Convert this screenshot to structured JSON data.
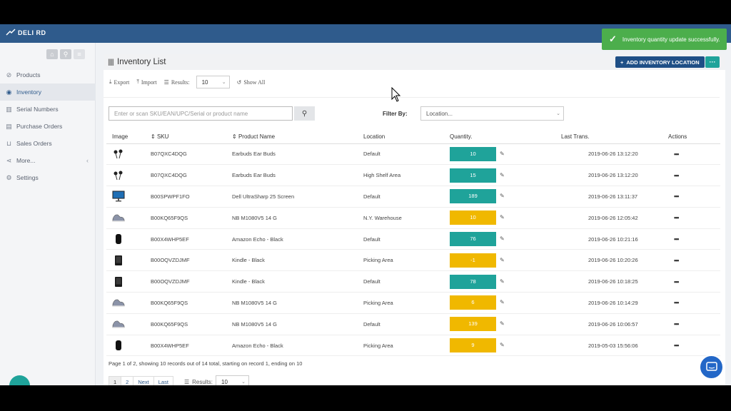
{
  "app": {
    "logo_text": "DELI  RD"
  },
  "toast": {
    "message": "Inventory quantity update successfully."
  },
  "sidebar": {
    "items": [
      {
        "label": "Products",
        "icon": "tag-icon"
      },
      {
        "label": "Inventory",
        "icon": "location-pin-icon",
        "active": true
      },
      {
        "label": "Serial Numbers",
        "icon": "barcode-icon"
      },
      {
        "label": "Purchase Orders",
        "icon": "document-icon"
      },
      {
        "label": "Sales Orders",
        "icon": "cart-icon"
      },
      {
        "label": "More...",
        "icon": "share-icon"
      },
      {
        "label": "Settings",
        "icon": "gear-icon"
      }
    ]
  },
  "panel": {
    "title": "Inventory List",
    "add_button": "ADD INVENTORY LOCATION",
    "more_button": "···"
  },
  "toolbar": {
    "export": "Export",
    "import": "Import",
    "results_label": "Results:",
    "results_value": "10",
    "show_all": "Show All"
  },
  "search": {
    "placeholder": "Enter or scan SKU/EAN/UPC/Serial or product name",
    "filter_label": "Filter By:",
    "location_placeholder": "Location..."
  },
  "table": {
    "headers": {
      "image": "Image",
      "sku": "SKU",
      "product": "Product Name",
      "location": "Location",
      "quantity": "Quantity.",
      "last": "Last Trans.",
      "actions": "Actions"
    },
    "rows": [
      {
        "img": "earbuds",
        "sku": "B07QXC4DQG",
        "product": "Earbuds Ear Buds",
        "location": "Default",
        "qty": "10",
        "qty_color": "#1fa39a",
        "last": "2019-06-26 13:12:20"
      },
      {
        "img": "earbuds",
        "sku": "B07QXC4DQG",
        "product": "Earbuds Ear Buds",
        "location": "High Shelf Area",
        "qty": "15",
        "qty_color": "#1fa39a",
        "last": "2019-06-26 13:12:20"
      },
      {
        "img": "monitor",
        "sku": "B00SPWPF1FO",
        "product": "Dell UltraSharp 25 Screen",
        "location": "Default",
        "qty": "189",
        "qty_color": "#1fa39a",
        "last": "2019-06-26 13:11:37"
      },
      {
        "img": "shoe",
        "sku": "B00KQ65F9QS",
        "product": "NB M1080V5 14 G",
        "location": "N.Y. Warehouse",
        "qty": "10",
        "qty_color": "#f0b800",
        "last": "2019-06-26 12:05:42"
      },
      {
        "img": "echo",
        "sku": "B00X4WHP5EF",
        "product": "Amazon Echo - Black",
        "location": "Default",
        "qty": "76",
        "qty_color": "#1fa39a",
        "last": "2019-06-26 10:21:16"
      },
      {
        "img": "kindle",
        "sku": "B00OQVZDJMF",
        "product": "Kindle - Black",
        "location": "Picking Area",
        "qty": "-1",
        "qty_color": "#f0b800",
        "last": "2019-06-26 10:20:26"
      },
      {
        "img": "kindle",
        "sku": "B00OQVZDJMF",
        "product": "Kindle - Black",
        "location": "Default",
        "qty": "78",
        "qty_color": "#1fa39a",
        "last": "2019-06-26 10:18:25"
      },
      {
        "img": "shoe",
        "sku": "B00KQ65F9QS",
        "product": "NB M1080V5 14 G",
        "location": "Picking Area",
        "qty": "6",
        "qty_color": "#f0b800",
        "last": "2019-06-26 10:14:29"
      },
      {
        "img": "shoe",
        "sku": "B00KQ65F9QS",
        "product": "NB M1080V5 14 G",
        "location": "Default",
        "qty": "139",
        "qty_color": "#f0b800",
        "last": "2019-06-26 10:06:57"
      },
      {
        "img": "echo",
        "sku": "B00X4WHP5EF",
        "product": "Amazon Echo - Black",
        "location": "Picking Area",
        "qty": "9",
        "qty_color": "#f0b800",
        "last": "2019-05-03 15:56:06"
      }
    ]
  },
  "pagination": {
    "summary": "Page 1 of 2, showing 10 records out of 14 total, starting on record 1, ending on 10",
    "pages": [
      "1",
      "2"
    ],
    "next": "Next",
    "last": "Last",
    "results_label": "Results:",
    "results_value": "10"
  }
}
